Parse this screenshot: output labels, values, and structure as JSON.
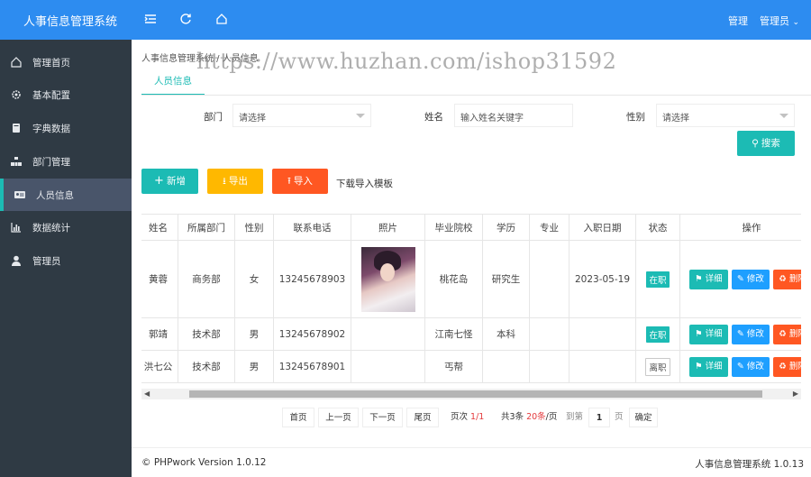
{
  "app": {
    "title": "人事信息管理系统"
  },
  "header": {
    "admin_label": "管理",
    "user_label": "管理员"
  },
  "sidebar": {
    "items": [
      {
        "label": "管理首页",
        "icon": "home-icon"
      },
      {
        "label": "基本配置",
        "icon": "gear-icon"
      },
      {
        "label": "字典数据",
        "icon": "book-icon"
      },
      {
        "label": "部门管理",
        "icon": "org-icon"
      },
      {
        "label": "人员信息",
        "icon": "id-card-icon",
        "active": true
      },
      {
        "label": "数据统计",
        "icon": "bar-chart-icon"
      },
      {
        "label": "管理员",
        "icon": "user-icon"
      }
    ]
  },
  "breadcrumb": "人事信息管理系统 / 人员信息",
  "watermark": "https://www.huzhan.com/ishop31592",
  "tab": {
    "label": "人员信息"
  },
  "filters": {
    "dept_label": "部门",
    "dept_value": "请选择",
    "name_label": "姓名",
    "name_placeholder": "输入姓名关键字",
    "gender_label": "性别",
    "gender_value": "请选择",
    "search_label": "搜索"
  },
  "toolbar": {
    "add_label": "新增",
    "export_label": "导出",
    "import_label": "导入",
    "template_label": "下载导入模板"
  },
  "table": {
    "headers": [
      "姓名",
      "所属部门",
      "性别",
      "联系电话",
      "照片",
      "毕业院校",
      "学历",
      "专业",
      "入职日期",
      "状态",
      "操作"
    ],
    "rows": [
      {
        "name": "黄蓉",
        "dept": "商务部",
        "gender": "女",
        "phone": "13245678903",
        "school": "桃花岛",
        "edu": "研究生",
        "major": "",
        "date": "2023-05-19",
        "status": "在职"
      },
      {
        "name": "郭靖",
        "dept": "技术部",
        "gender": "男",
        "phone": "13245678902",
        "school": "江南七怪",
        "edu": "本科",
        "major": "",
        "date": "",
        "status": "在职"
      },
      {
        "name": "洪七公",
        "dept": "技术部",
        "gender": "男",
        "phone": "13245678901",
        "school": "丐帮",
        "edu": "",
        "major": "",
        "date": "",
        "status": "离职"
      }
    ],
    "ops": {
      "detail": "详细",
      "edit": "修改",
      "delete": "删除"
    }
  },
  "pager": {
    "first": "首页",
    "prev": "上一页",
    "next": "下一页",
    "last": "尾页",
    "page_prefix": "页次",
    "page_info": "1/1",
    "total_prefix": "共3条",
    "per_page": "20条",
    "total_suffix": "/页",
    "goto_label": "到第",
    "goto_value": "1",
    "page_unit": "页",
    "confirm": "确定"
  },
  "footer": {
    "left": "© PHPwork Version 1.0.12",
    "right": "人事信息管理系统 1.0.13"
  },
  "colors": {
    "header": "#2d8cf0",
    "sidebar": "#2f3a44",
    "teal": "#1cbbb4",
    "orange": "#ffb800",
    "red_orange": "#ff5722",
    "blue": "#1e9fff"
  }
}
